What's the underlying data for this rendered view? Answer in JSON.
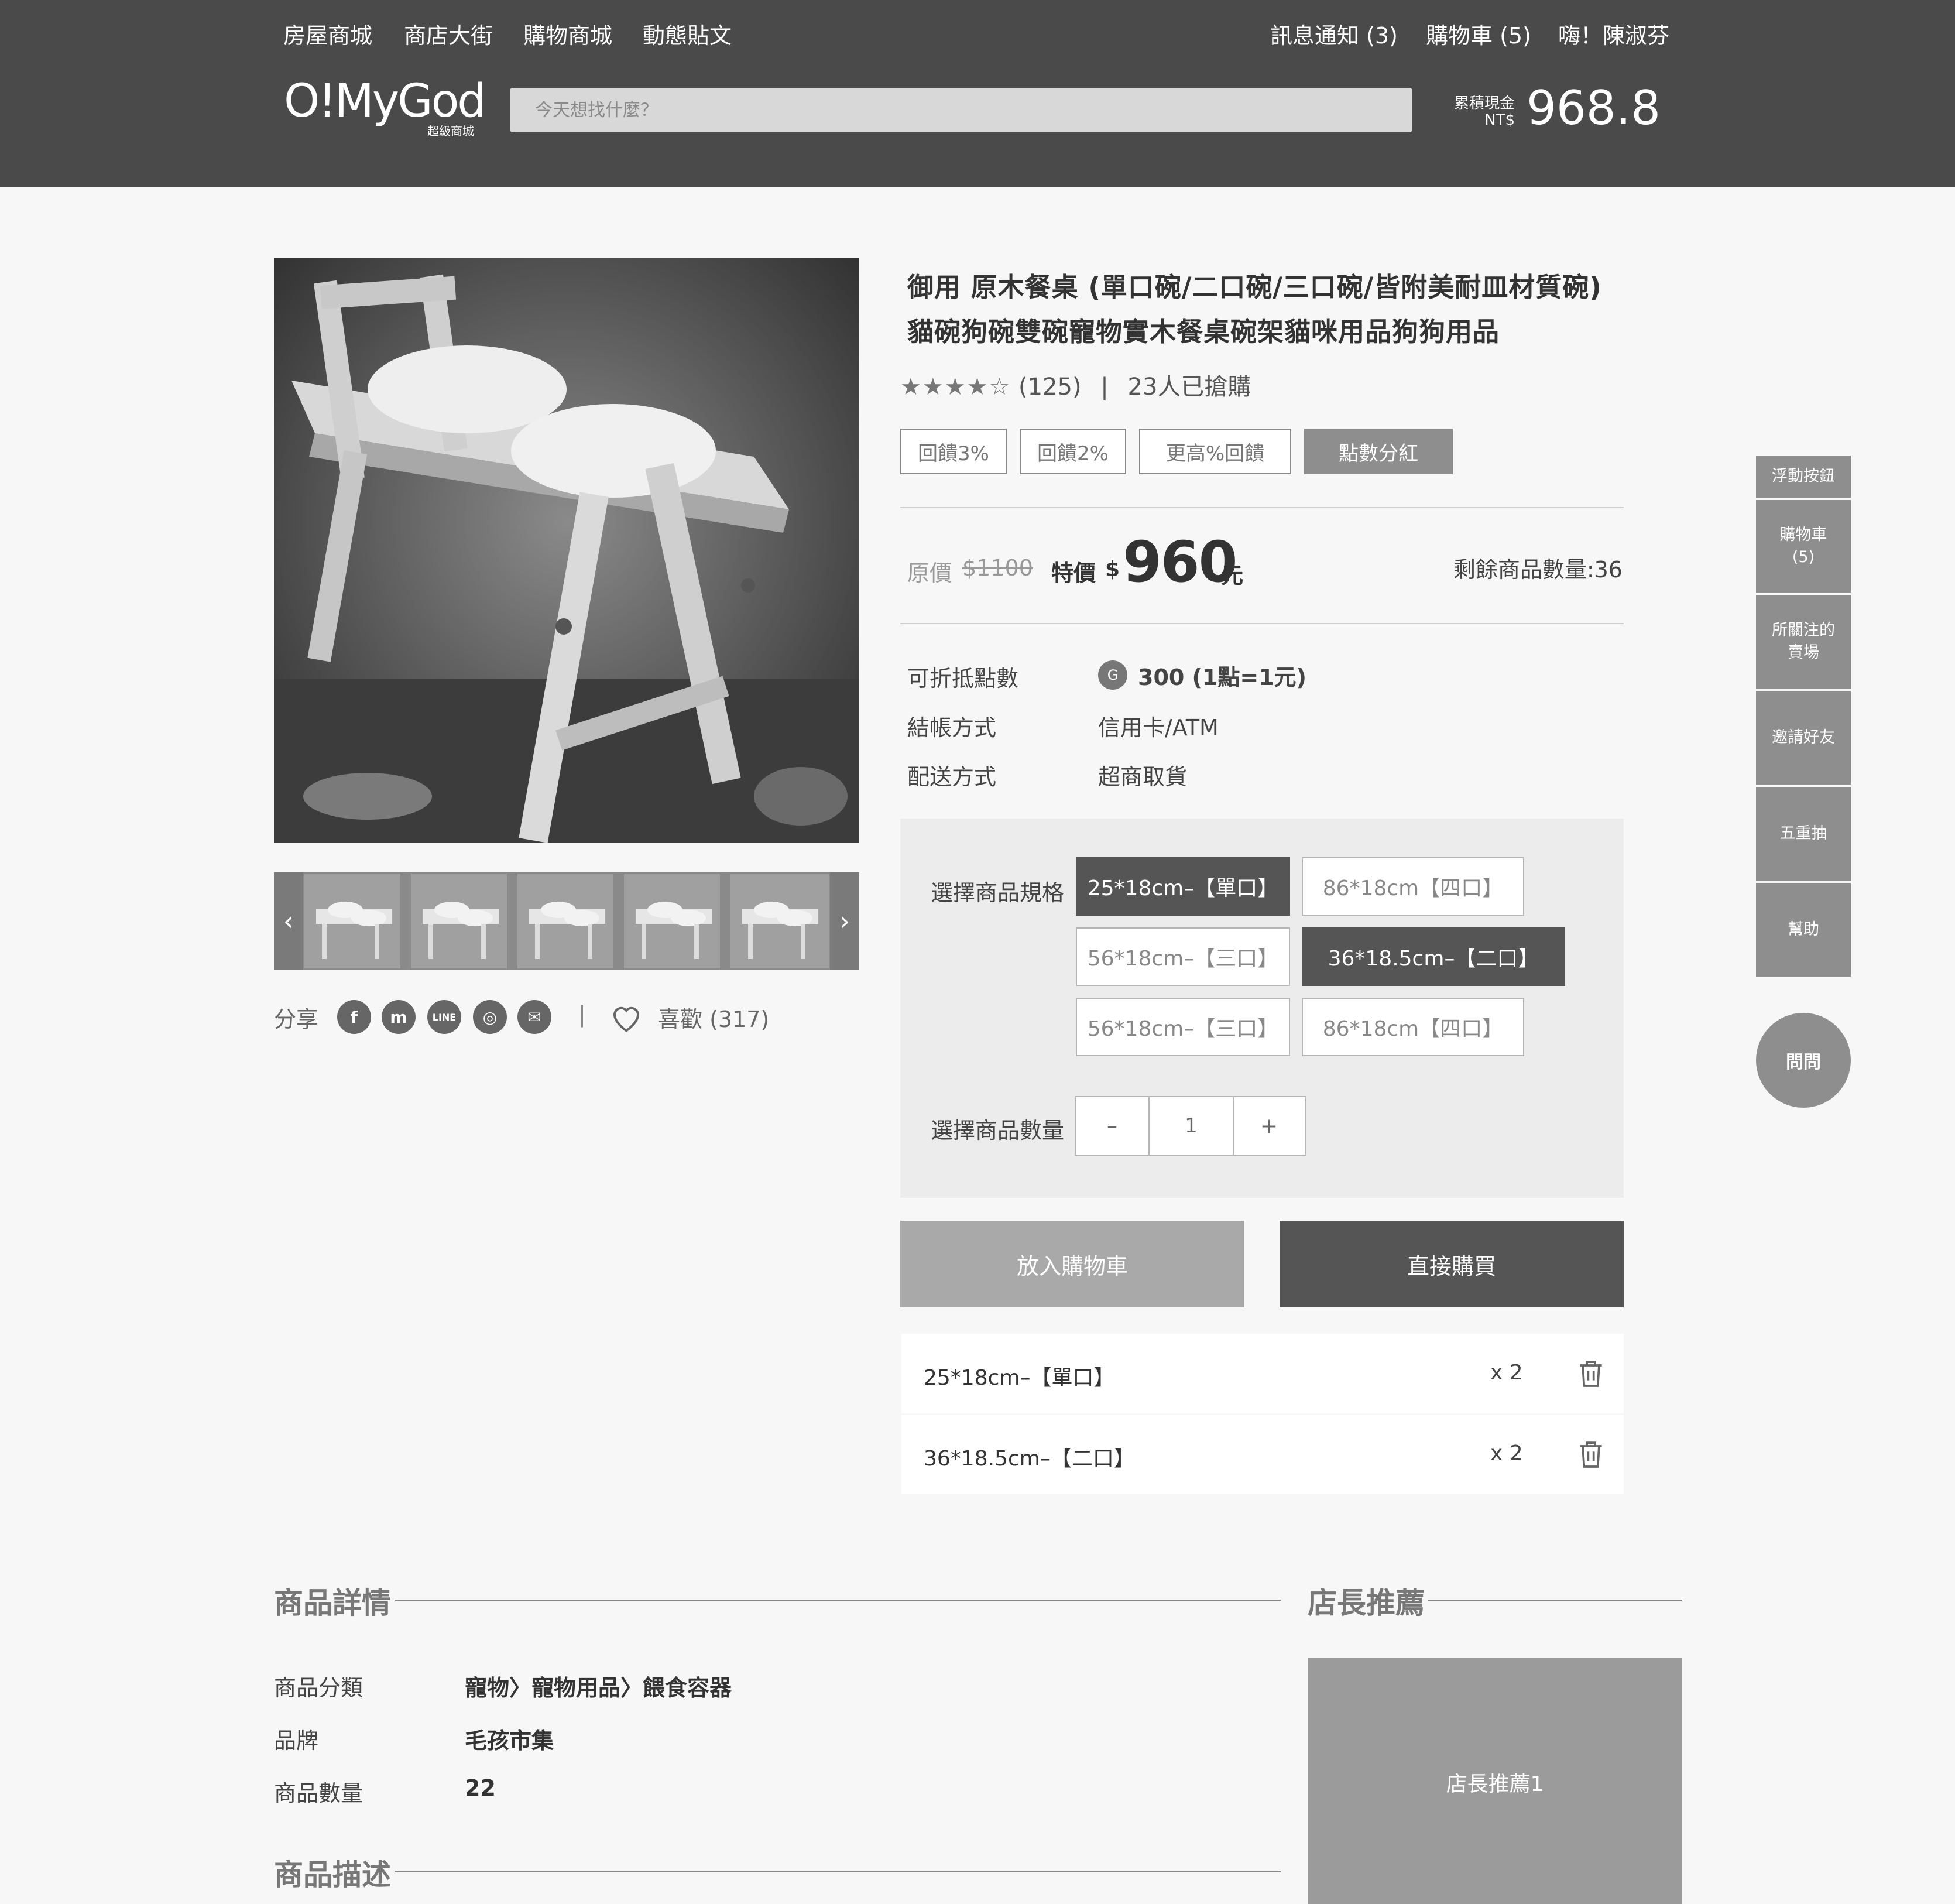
{
  "topnav": {
    "left": [
      "房屋商城",
      "商店大街",
      "購物商城",
      "動態貼文"
    ],
    "notifications": "訊息通知 (3)",
    "cart": "購物車 (5)",
    "greeting": "嗨！陳淑芬"
  },
  "brand": {
    "logo": "O!MyGod",
    "logo_sub": "超級商城"
  },
  "search": {
    "placeholder": "今天想找什麼？"
  },
  "cash": {
    "label": "累積現金",
    "currency": "NT$",
    "value": "968.8"
  },
  "product": {
    "title_line1": "御用 原木餐桌 (單口碗/二口碗/三口碗/皆附美耐皿材質碗)",
    "title_line2": "貓碗狗碗雙碗寵物實木餐桌碗架貓咪用品狗狗用品",
    "stars": "★★★★☆",
    "rating_count": "(125)",
    "sold": "23人已搶購",
    "tags": [
      "回饋3%",
      "回饋2%",
      "更高%回饋",
      "點數分紅"
    ],
    "orig_label": "原價",
    "orig_price": "$1100",
    "special_label": "特價",
    "special_currency": "$",
    "special_price": "960",
    "unit": "元",
    "remaining": "剩餘商品數量:36",
    "points_label": "可折抵點數",
    "points_coin": "G",
    "points_value": "300 (1點=1元)",
    "payment_label": "結帳方式",
    "payment_value": "信用卡/ATM",
    "shipping_label": "配送方式",
    "shipping_value": "超商取貨"
  },
  "share": {
    "label": "分享",
    "networks": [
      "f",
      "m",
      "LINE",
      "◎",
      "✉"
    ],
    "like_label": "喜歡 (317)"
  },
  "spec": {
    "label": "選擇商品規格",
    "options": [
      "25*18cm–【單口】",
      "86*18cm【四口】",
      "56*18cm–【三口】",
      "36*18.5cm–【二口】",
      "56*18cm–【三口】",
      "86*18cm【四口】"
    ],
    "qty_label": "選擇商品數量",
    "qty_minus": "–",
    "qty_value": "1",
    "qty_plus": "+"
  },
  "actions": {
    "add_to_cart": "放入購物車",
    "buy_now": "直接購買"
  },
  "selected_items": [
    {
      "name": "25*18cm–【單口】",
      "qty": "x 2"
    },
    {
      "name": "36*18.5cm–【二口】",
      "qty": "x 2"
    }
  ],
  "sidebar": {
    "items": [
      "浮動按鈕",
      "購物車\n(5)",
      "所關注的\n賣場",
      "邀請好友",
      "五重抽",
      "幫助"
    ],
    "ask": "問問"
  },
  "details": {
    "title": "商品詳情",
    "rows": [
      {
        "label": "商品分類",
        "value": "寵物〉寵物用品〉餵食容器"
      },
      {
        "label": "品牌",
        "value": "毛孩市集"
      },
      {
        "label": "商品數量",
        "value": "22"
      }
    ],
    "desc_title": "商品描述"
  },
  "recommend": {
    "title": "店長推薦",
    "card": "店長推薦1"
  },
  "colors": {
    "header": "#4a4a4a",
    "accent_dark": "#555555",
    "accent_light": "#a9a9a9",
    "side": "#8e8e8e"
  }
}
